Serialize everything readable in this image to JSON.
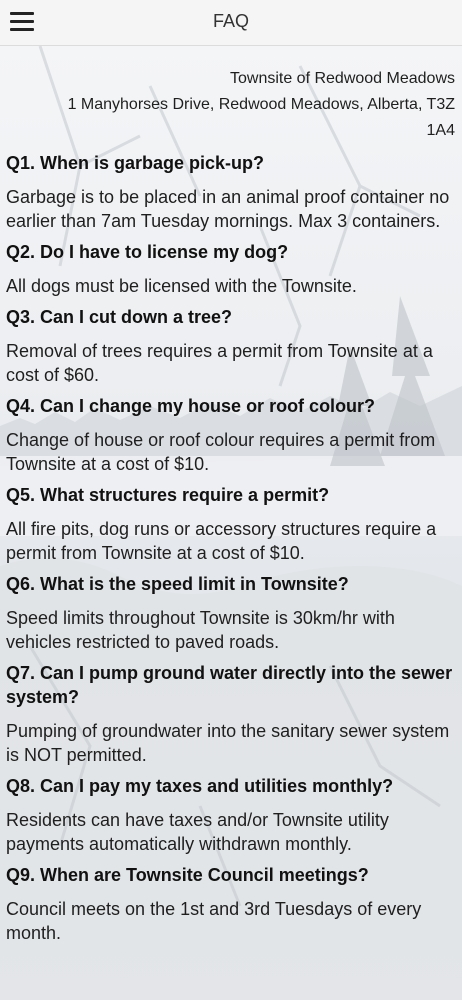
{
  "header": {
    "title": "FAQ"
  },
  "address": {
    "line1": "Townsite of Redwood Meadows",
    "line2": "1 Manyhorses Drive, Redwood Meadows, Alberta, T3Z",
    "line3": "1A4"
  },
  "faq": [
    {
      "q": "Q1. When is garbage pick-up?",
      "a": "Garbage is to be placed in an animal proof container no earlier than 7am Tuesday mornings. Max 3 containers."
    },
    {
      "q": "Q2. Do I have to license my dog?",
      "a": "All dogs must be licensed with the Townsite."
    },
    {
      "q": "Q3. Can I cut down a tree?",
      "a": "Removal of trees requires a permit from Townsite at a cost of $60."
    },
    {
      "q": "Q4. Can I change my house or roof colour?",
      "a": "Change of house or roof colour requires a permit from Townsite at a cost of $10."
    },
    {
      "q": "Q5. What structures require a permit?",
      "a": "All fire pits, dog runs or accessory structures require a permit from Townsite at a cost of $10."
    },
    {
      "q": "Q6. What is the speed limit in Townsite?",
      "a": "Speed limits throughout Townsite is 30km/hr with vehicles restricted to paved roads."
    },
    {
      "q": "Q7. Can I pump ground water directly into the sewer system?",
      "a": "Pumping of groundwater into the sanitary sewer system is NOT permitted."
    },
    {
      "q": "Q8. Can I pay my taxes and utilities monthly?",
      "a": "Residents can have taxes and/or Townsite utility payments automatically withdrawn monthly."
    },
    {
      "q": "Q9. When are Townsite Council meetings?",
      "a": "Council meets on the 1st and 3rd Tuesdays of every month."
    }
  ]
}
